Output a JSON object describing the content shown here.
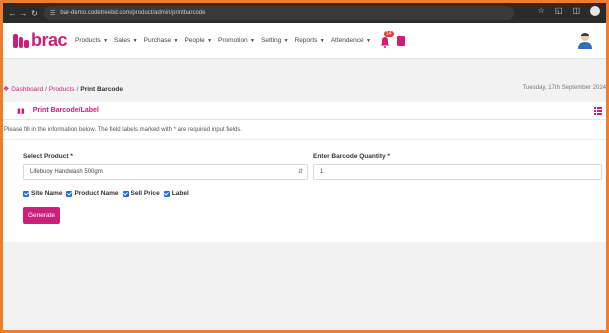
{
  "browser": {
    "url": "bar-demo.codetreebd.com/product/admin/printbarcode"
  },
  "app": {
    "logo_text": "brac",
    "accent": "#cc1f7a",
    "menu": [
      {
        "label": "Products"
      },
      {
        "label": "Sales"
      },
      {
        "label": "Purchase"
      },
      {
        "label": "People"
      },
      {
        "label": "Promotion"
      },
      {
        "label": "Setting"
      },
      {
        "label": "Reports"
      },
      {
        "label": "Attendence"
      }
    ],
    "notification_count": "14"
  },
  "breadcrumb": {
    "items": [
      "Dashboard",
      "Products"
    ],
    "current": "Print Barcode"
  },
  "date_text": "Tuesday, 17th September 2024",
  "card": {
    "title": "Print Barcode/Label",
    "instructions": "Please fill in the information below. The field labels marked with * are required input fields."
  },
  "form": {
    "product_label": "Select Product *",
    "product_value": "Lifebuoy Handwash 500gm",
    "qty_label": "Enter Barcode Quantity *",
    "qty_value": "1",
    "checkboxes": [
      {
        "label": "Site Name",
        "checked": true
      },
      {
        "label": "Product Name",
        "checked": true
      },
      {
        "label": "Sell Price",
        "checked": true
      },
      {
        "label": "Label",
        "checked": true
      }
    ],
    "generate_label": "Generate"
  }
}
